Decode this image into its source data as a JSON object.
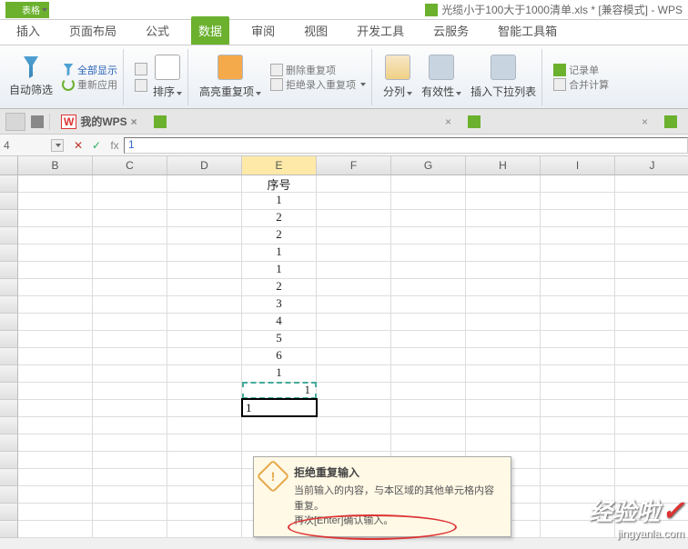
{
  "title": {
    "left_badge": "表格",
    "doc_name": "光缆小于100大于1000清单.xls * [兼容模式] - WPS"
  },
  "tabs": {
    "insert": "插入",
    "page_layout": "页面布局",
    "formulas": "公式",
    "data": "数据",
    "review": "审阅",
    "view": "视图",
    "dev_tools": "开发工具",
    "cloud": "云服务",
    "smart_tools": "智能工具箱"
  },
  "ribbon": {
    "auto_filter": "自动筛选",
    "show_all": "全部显示",
    "reapply": "重新应用",
    "sort": "排序",
    "highlight_dup": "高亮重复项",
    "remove_dup": "删除重复项",
    "reject_dup": "拒绝录入重复项",
    "text_to_cols": "分列",
    "validation": "有效性",
    "insert_dropdown": "插入下拉列表",
    "record_entry": "记录单",
    "consolidate": "合并计算"
  },
  "doc_tabs": {
    "my_wps": "我的WPS"
  },
  "formula_bar": {
    "name_box": "4",
    "fx": "fx",
    "value": "1"
  },
  "columns": [
    "",
    "B",
    "C",
    "D",
    "E",
    "F",
    "G",
    "H",
    "I",
    "J"
  ],
  "chart_data": {
    "type": "table",
    "header_cell": "序号",
    "column": "E",
    "values": [
      "1",
      "2",
      "2",
      "1",
      "1",
      "2",
      "3",
      "4",
      "5",
      "6",
      "1",
      "1"
    ],
    "active_input": "1"
  },
  "tooltip": {
    "title": "拒绝重复输入",
    "line1": "当前输入的内容，与本区域的其他单元格内容重复。",
    "line2": "再次[Enter]确认输入。"
  },
  "watermark": {
    "main": "经验啦",
    "sub": "jingyanla.com"
  }
}
